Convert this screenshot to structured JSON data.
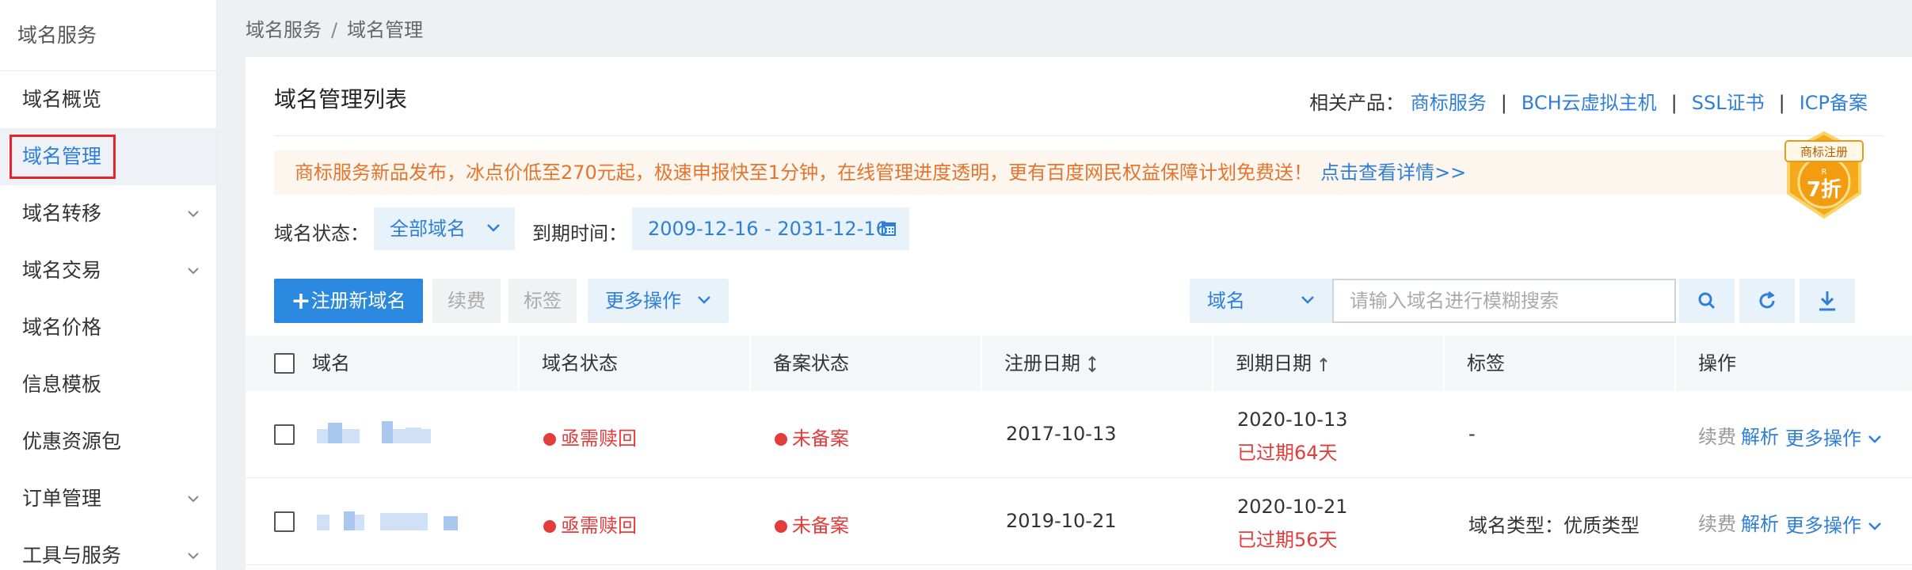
{
  "sidebar": {
    "title": "域名服务",
    "items": [
      {
        "label": "域名概览"
      },
      {
        "label": "域名管理"
      },
      {
        "label": "域名转移"
      },
      {
        "label": "域名交易"
      },
      {
        "label": "域名价格"
      },
      {
        "label": "信息模板"
      },
      {
        "label": "优惠资源包"
      },
      {
        "label": "订单管理"
      },
      {
        "label": "工具与服务"
      }
    ]
  },
  "breadcrumb": {
    "root": "域名服务",
    "separator": "/",
    "current": "域名管理"
  },
  "panel": {
    "title": "域名管理列表",
    "related_label": "相关产品：",
    "related_links": [
      "商标服务",
      "BCH云虚拟主机",
      "SSL证书",
      "ICP备案"
    ],
    "related_separator": "|"
  },
  "notice": {
    "text": "商标服务新品发布，冰点价低至270元起，极速申报快至1分钟，在线管理进度透明，更有百度网民权益保障计划免费送！",
    "link": "点击查看详情>>"
  },
  "promo_badge": {
    "top_text": "商标注册",
    "discount": "7折",
    "mark": "R"
  },
  "filters": {
    "status_label": "域名状态：",
    "status_value": "全部域名",
    "expire_label": "到期时间：",
    "expire_range": "2009-12-16 - 2031-12-16"
  },
  "toolbar": {
    "register_label": "注册新域名",
    "renew_label": "续费",
    "tag_label": "标签",
    "more_label": "更多操作",
    "search_type": "域名",
    "search_placeholder": "请输入域名进行模糊搜索"
  },
  "table": {
    "columns": [
      "域名",
      "域名状态",
      "备案状态",
      "注册日期",
      "到期日期",
      "标签",
      "操作"
    ],
    "rows": [
      {
        "status": "亟需赎回",
        "icp": "未备案",
        "reg_date": "2017-10-13",
        "exp_date": "2020-10-13",
        "expired_note": "已过期64天",
        "tag": "-",
        "ops": [
          "续费",
          "解析",
          "更多操作"
        ]
      },
      {
        "status": "亟需赎回",
        "icp": "未备案",
        "reg_date": "2019-10-21",
        "exp_date": "2020-10-21",
        "expired_note": "已过期56天",
        "tag": "域名类型：优质类型",
        "ops": [
          "续费",
          "解析",
          "更多操作"
        ]
      }
    ]
  },
  "colors": {
    "accent": "#2f7fd8",
    "primary_button": "#2b8ae0",
    "danger": "#e23c3c",
    "notice_text": "#e4752e",
    "highlight_box": "#e5252a"
  }
}
